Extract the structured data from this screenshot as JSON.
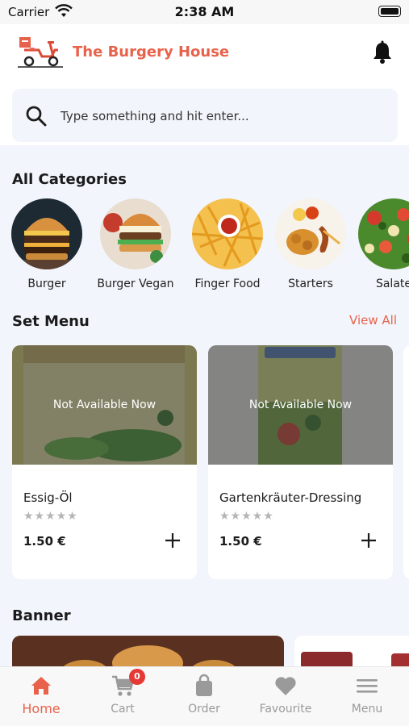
{
  "status_bar": {
    "carrier": "Carrier",
    "time": "2:38 AM"
  },
  "header": {
    "brand": "The Burgery House"
  },
  "search": {
    "placeholder": "Type something and hit enter..."
  },
  "categories": {
    "title": "All Categories",
    "items": [
      {
        "label": "Burger"
      },
      {
        "label": "Burger Vegan"
      },
      {
        "label": "Finger Food"
      },
      {
        "label": "Starters"
      },
      {
        "label": "Salate"
      }
    ]
  },
  "set_menu": {
    "title": "Set Menu",
    "view_all": "View All",
    "items": [
      {
        "name": "Essig-Öl",
        "price": "1.50 €",
        "status": "Not Available Now",
        "stars": "★★★★★",
        "rating": 0
      },
      {
        "name": "Gartenkräuter-Dressing",
        "price": "1.50 €",
        "status": "Not Available Now",
        "stars": "★★★★★",
        "rating": 0
      }
    ]
  },
  "banner": {
    "title": "Banner"
  },
  "bottom_nav": {
    "items": [
      {
        "label": "Home",
        "icon": "home-icon",
        "active": true
      },
      {
        "label": "Cart",
        "icon": "cart-icon",
        "badge": "0"
      },
      {
        "label": "Order",
        "icon": "bag-icon"
      },
      {
        "label": "Favourite",
        "icon": "heart-icon"
      },
      {
        "label": "Menu",
        "icon": "menu-icon"
      }
    ]
  },
  "colors": {
    "accent": "#e8624b",
    "background": "#f2f5fb",
    "badge": "#e53935"
  }
}
